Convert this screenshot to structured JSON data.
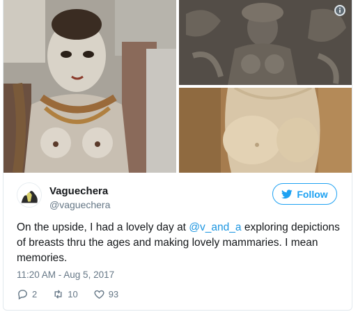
{
  "tweet": {
    "author_name": "Vaguechera",
    "author_handle": "@vaguechera",
    "follow_label": "Follow",
    "text_part1": "On the upside, I had a lovely day at ",
    "mention": "@v_and_a",
    "text_part2": " exploring depictions of breasts thru the ages and making lovely mammaries. I mean memories.",
    "timestamp": "11:20 AM - Aug 5, 2017",
    "reply_count": "2",
    "retweet_count": "10",
    "like_count": "93"
  },
  "colors": {
    "accent": "#1da1f2",
    "mention": "#1b95e0",
    "secondary_text": "#657786"
  },
  "icons": [
    "info-icon",
    "twitter-bird-icon",
    "reply-icon",
    "retweet-icon",
    "heart-icon"
  ]
}
